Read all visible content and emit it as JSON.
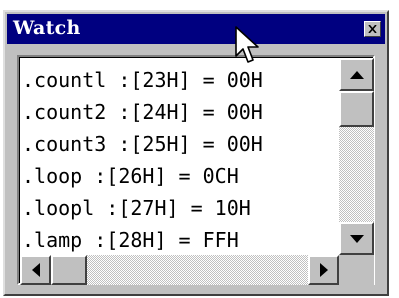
{
  "window": {
    "title": "Watch",
    "close_icon": "close-icon"
  },
  "watch": {
    "items": [
      ".countl :[23H] = 00H",
      ".count2 :[24H] = 00H",
      ".count3 :[25H] = 00H",
      ".loop :[26H] = 0CH",
      ".loopl :[27H] = 10H",
      ".lamp :[28H] = FFH"
    ]
  },
  "scrollbars": {
    "vertical": {
      "up_icon": "arrow-up-icon",
      "down_icon": "arrow-down-icon"
    },
    "horizontal": {
      "left_icon": "arrow-left-icon",
      "right_icon": "arrow-right-icon"
    }
  },
  "colors": {
    "title_bar": "#000080",
    "face": "#c0c0c0",
    "list_background": "#ffffff"
  },
  "cursor_icon": "mouse-pointer-icon"
}
